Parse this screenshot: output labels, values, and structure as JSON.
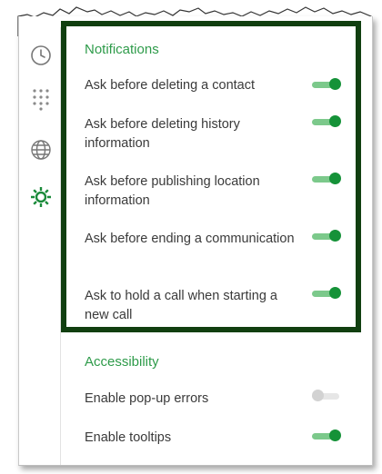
{
  "sidebar": {
    "items": [
      {
        "icon": "clock-icon"
      },
      {
        "icon": "dialpad-icon"
      },
      {
        "icon": "globe-icon"
      },
      {
        "icon": "gear-icon",
        "active": true
      }
    ]
  },
  "notifications": {
    "title": "Notifications",
    "items": [
      {
        "label": "Ask before deleting a contact",
        "enabled": true
      },
      {
        "label": "Ask before deleting history information",
        "enabled": true
      },
      {
        "label": "Ask before publishing location information",
        "enabled": true
      },
      {
        "label": "Ask before ending a communication",
        "enabled": true
      },
      {
        "label": "Ask to hold a call when starting a new call",
        "enabled": true
      }
    ]
  },
  "accessibility": {
    "title": "Accessibility",
    "items": [
      {
        "label": "Enable pop-up errors",
        "enabled": false
      },
      {
        "label": "Enable tooltips",
        "enabled": true
      }
    ]
  },
  "colors": {
    "accent": "#2e9b4a",
    "toggle_on": "#159238",
    "highlight_border": "#113f10"
  }
}
